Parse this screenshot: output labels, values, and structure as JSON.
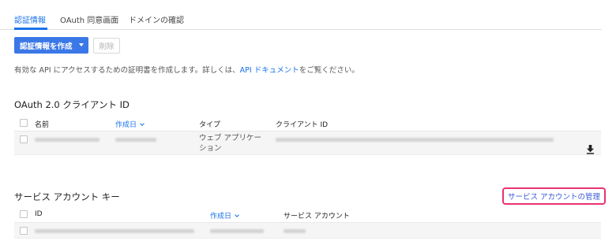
{
  "tabs": [
    {
      "label": "認証情報",
      "active": true
    },
    {
      "label": "OAuth 同意画面",
      "active": false
    },
    {
      "label": "ドメインの確認",
      "active": false
    }
  ],
  "toolbar": {
    "create_label": "認証情報を作成",
    "delete_label": "削除"
  },
  "description": {
    "prefix": "有効な API にアクセスするための証明書を作成します。詳しくは、",
    "link": "API ドキュメント",
    "suffix": "をご覧ください。"
  },
  "oauth": {
    "title": "OAuth 2.0 クライアント ID",
    "headers": {
      "name": "名前",
      "created": "作成日",
      "type": "タイプ",
      "client_id": "クライアント ID"
    },
    "row": {
      "type_line1": "ウェブ アプリケー",
      "type_line2": "ション"
    }
  },
  "service": {
    "title": "サービス アカウント キー",
    "manage_link": "サービス アカウントの管理",
    "headers": {
      "id": "ID",
      "created": "作成日",
      "account": "サービス アカウント"
    }
  },
  "colors": {
    "accent": "#1a73e8",
    "button": "#3b78e7",
    "highlight": "#e8336f"
  },
  "icons": {
    "sort": "chevron-down-icon",
    "download": "download-icon"
  }
}
